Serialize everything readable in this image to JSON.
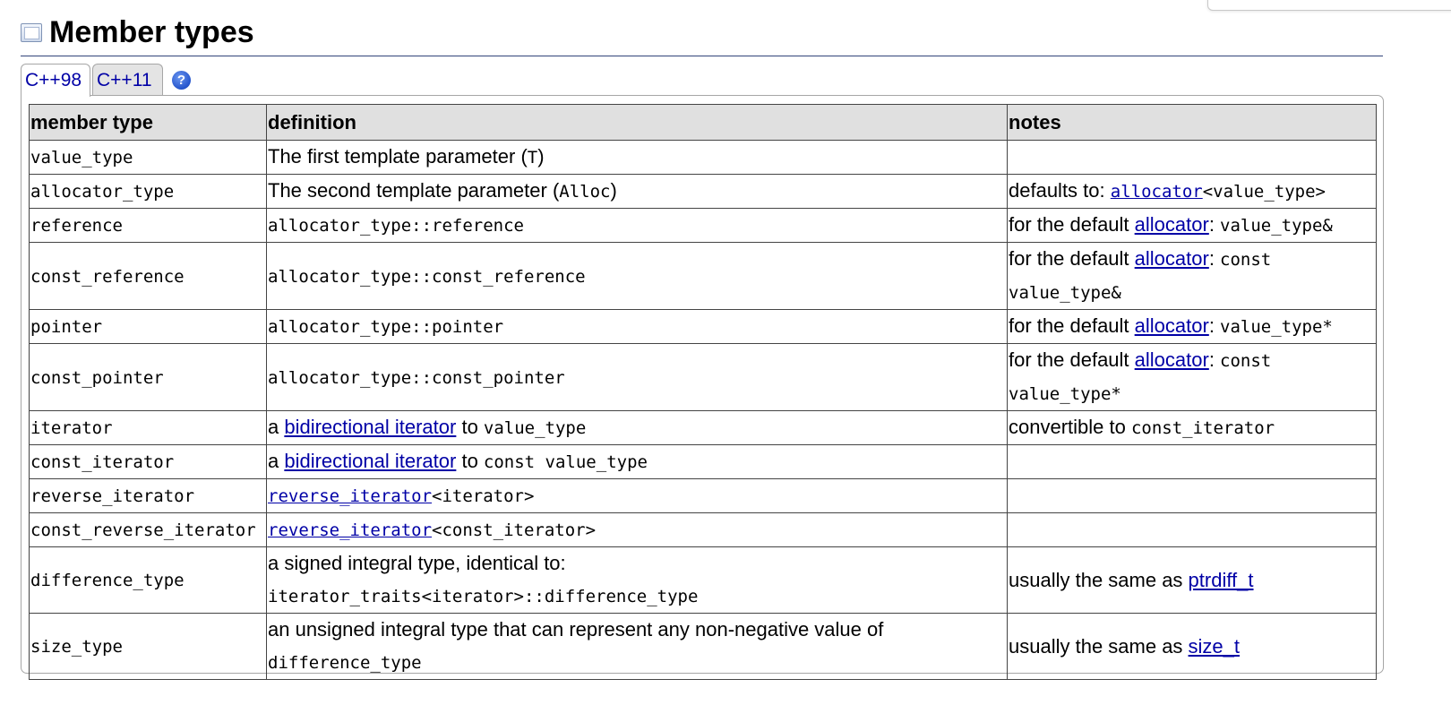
{
  "section": {
    "title": "Member types",
    "icon": "book-icon"
  },
  "tabs": [
    {
      "label": "C++98",
      "active": true
    },
    {
      "label": "C++11",
      "active": false
    }
  ],
  "help_icon": "?",
  "table": {
    "headers": [
      "member type",
      "definition",
      "notes"
    ],
    "rows": {
      "value_type": {
        "name": "value_type",
        "def_text": "The first template parameter (",
        "def_code": "T",
        "def_end": ")"
      },
      "allocator_type": {
        "name": "allocator_type",
        "def_text": "The second template parameter (",
        "def_code": "Alloc",
        "def_end": ")",
        "note_text": "defaults to: ",
        "note_link": "allocator",
        "note_code": "<value_type>"
      },
      "reference": {
        "name": "reference",
        "def_code": "allocator_type::reference",
        "note_text": "for the default ",
        "note_link": "allocator",
        "note_sep": ": ",
        "note_code": "value_type&"
      },
      "const_reference": {
        "name": "const_reference",
        "def_code": "allocator_type::const_reference",
        "note_text": "for the default ",
        "note_link": "allocator",
        "note_sep": ": ",
        "note_code_1": "const",
        "note_code_2": "value_type&"
      },
      "pointer": {
        "name": "pointer",
        "def_code": "allocator_type::pointer",
        "note_text": "for the default ",
        "note_link": "allocator",
        "note_sep": ": ",
        "note_code": "value_type*"
      },
      "const_pointer": {
        "name": "const_pointer",
        "def_code": "allocator_type::const_pointer",
        "note_text": "for the default ",
        "note_link": "allocator",
        "note_sep": ": ",
        "note_code_1": "const",
        "note_code_2": "value_type*"
      },
      "iterator": {
        "name": "iterator",
        "def_text": "a ",
        "def_link": "bidirectional iterator",
        "def_mid": " to ",
        "def_code": "value_type",
        "note_text": "convertible to ",
        "note_code": "const_iterator"
      },
      "const_iterator": {
        "name": "const_iterator",
        "def_text": "a ",
        "def_link": "bidirectional iterator",
        "def_mid": " to ",
        "def_code": "const value_type"
      },
      "reverse_iterator": {
        "name": "reverse_iterator",
        "def_link": "reverse_iterator",
        "def_code": "<iterator>"
      },
      "const_reverse_iterator": {
        "name": "const_reverse_iterator",
        "def_link": "reverse_iterator",
        "def_code": "<const_iterator>"
      },
      "difference_type": {
        "name": "difference_type",
        "def_text": "a signed integral type, identical to:",
        "def_code": "iterator_traits<iterator>::difference_type",
        "note_text": "usually the same as ",
        "note_link": "ptrdiff_t"
      },
      "size_type": {
        "name": "size_type",
        "def_text": "an unsigned integral type that can represent any non-negative value of",
        "def_code": "difference_type",
        "note_text": "usually the same as ",
        "note_link": "size_t"
      }
    }
  },
  "colors": {
    "link": "#0000a6",
    "header_bg": "#e0e0e0",
    "rule": "#33447a",
    "inactive_tab_bg": "#e4e4e4"
  }
}
